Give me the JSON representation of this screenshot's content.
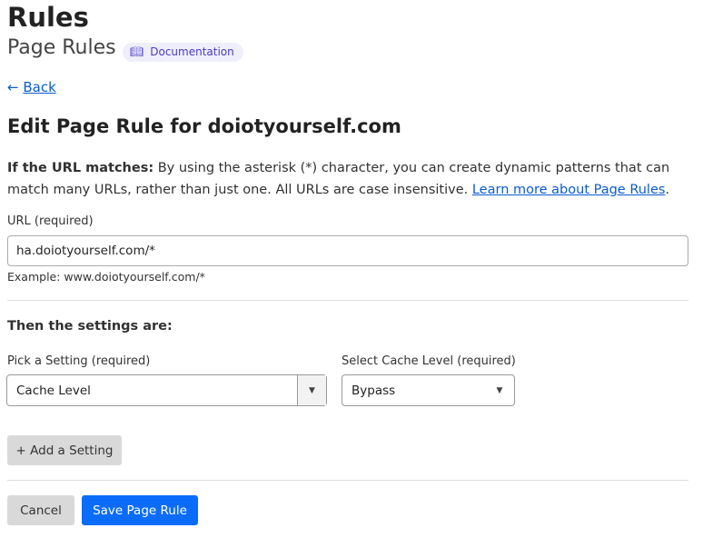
{
  "header": {
    "title": "Rules",
    "subtitle": "Page Rules",
    "doc_label": "Documentation",
    "doc_icon": "book-icon"
  },
  "back": {
    "label": "Back",
    "icon": "arrow-left-icon"
  },
  "edit_title": "Edit Page Rule for doiotyourself.com",
  "description": {
    "bold": "If the URL matches:",
    "text": " By using the asterisk (*) character, you can create dynamic patterns that can match many URLs, rather than just one. All URLs are case insensitive. ",
    "link": "Learn more about Page Rules",
    "end": "."
  },
  "url": {
    "label": "URL (required)",
    "value": "ha.doiotyourself.com/*",
    "example": "Example: www.doiotyourself.com/*"
  },
  "settings": {
    "heading": "Then the settings are:",
    "pick_label": "Pick a Setting (required)",
    "pick_value": "Cache Level",
    "cache_label": "Select Cache Level (required)",
    "cache_value": "Bypass",
    "add_label": "+ Add a Setting"
  },
  "actions": {
    "cancel": "Cancel",
    "save": "Save Page Rule"
  },
  "colors": {
    "primary": "#0b6cf9",
    "link": "#0a5ccf",
    "badge_bg": "#efeefb"
  }
}
